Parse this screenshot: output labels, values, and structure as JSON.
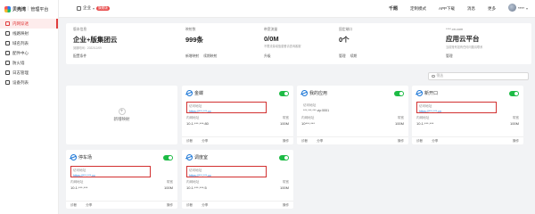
{
  "app": {
    "name": "贝壳湾",
    "section": "管理平台"
  },
  "sidebar": {
    "items": [
      {
        "label": "内网穿透",
        "active": true
      },
      {
        "label": "线路映射"
      },
      {
        "label": "域名列表"
      },
      {
        "label": "配件中心"
      },
      {
        "label": "防火墙"
      },
      {
        "label": "日志管理"
      },
      {
        "label": "设备列表"
      }
    ]
  },
  "topbar": {
    "org": "企业",
    "badge": "旗舰版",
    "links": [
      "千题",
      "定制模式",
      "APP下载",
      "消息",
      "更多"
    ],
    "user": "****"
  },
  "summary": {
    "cols": [
      {
        "label": "版本信息",
        "value": "企业+版集团云",
        "sub": "到期时间：2022/12/09"
      },
      {
        "label": "映射数",
        "value": "999条",
        "sub": ""
      },
      {
        "label": "带宽流量",
        "value": "0/0M",
        "sub": "不限流量增值套餐请咨询客服"
      },
      {
        "label": "固定端口",
        "value": "0个",
        "sub": ""
      },
      {
        "label": "****.cn.com",
        "value": "应用云平台",
        "sub": "当前账号如有任何问题请联系"
      }
    ],
    "links": [
      [
        "配置条件"
      ],
      [
        "新增映射",
        "续期映射"
      ],
      [
        "升级"
      ],
      [
        "管理",
        "续期"
      ],
      [
        "管理"
      ]
    ]
  },
  "filter": {
    "placeholder": "筛选"
  },
  "add_card": {
    "label": "新增映射"
  },
  "cards": [
    {
      "name": "金蝶",
      "addr_label": "访问地址",
      "addr": "https://***.***.cc",
      "highlight": true,
      "inner_label": "内网地址",
      "inner": "10.1.***.***:80",
      "bw_label": "带宽",
      "bw": "100M",
      "footer": [
        "诊断",
        "分享",
        "操作"
      ]
    },
    {
      "name": "我的应用",
      "addr_label": "访问地址",
      "addr": "***.***.***.vip:5551",
      "highlight": false,
      "inner_label": "内网地址",
      "inner": "10***.***",
      "bw_label": "带宽",
      "bw": "100M",
      "footer": [
        "诊断",
        "分享",
        "操作"
      ]
    },
    {
      "name": "新开口",
      "addr_label": "访问地址",
      "addr": "https://***.***.cn",
      "highlight": true,
      "inner_label": "内网地址",
      "inner": "10.1.***.***",
      "bw_label": "带宽",
      "bw": "100M",
      "footer": [
        "诊断",
        "分享",
        "操作"
      ]
    },
    {
      "name": "停车场",
      "addr_label": "访问地址",
      "addr": "https://***.***.cc",
      "highlight": true,
      "inner_label": "内网地址",
      "inner": "10.1.***.***",
      "bw_label": "带宽",
      "bw": "100M",
      "footer": [
        "诊断",
        "分享",
        "操作"
      ]
    },
    {
      "name": "调度室",
      "addr_label": "访问地址",
      "addr": "https://***.***.cc",
      "highlight": true,
      "inner_label": "内网地址",
      "inner": "10.1.***.***:5",
      "bw_label": "带宽",
      "bw": "100M",
      "footer": [
        "诊断",
        "分享",
        "操作"
      ]
    }
  ],
  "colors": {
    "accent": "#e03c3c",
    "toggle_on": "#1dbb45",
    "link": "#1e78d7"
  }
}
